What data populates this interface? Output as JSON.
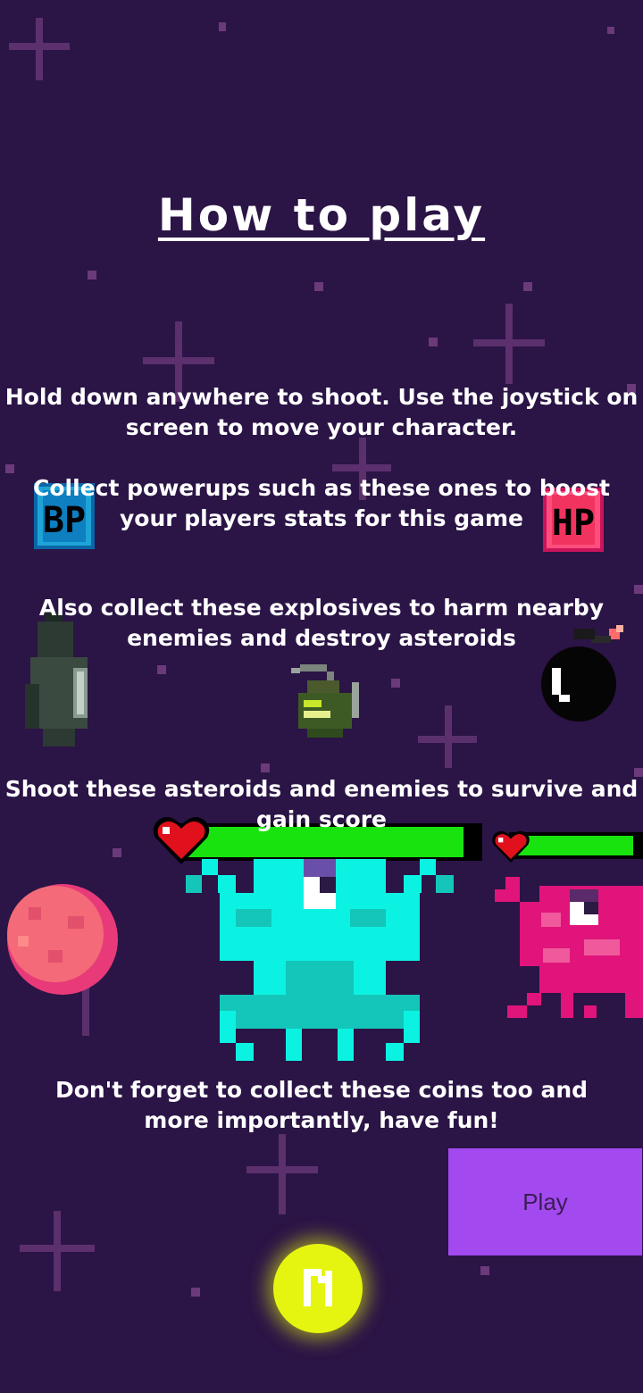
{
  "title": "How to play",
  "instructions": {
    "controls": "Hold down anywhere to shoot. Use the joystick on screen to move your character.",
    "powerups": "Collect powerups such as these ones to boost your players stats for this game",
    "explosives": "Also collect these explosives to harm nearby enemies and destroy asteroids",
    "enemies": "Shoot these asteroids and enemies to survive and gain score",
    "coins": "Don't forget to collect these coins too and more importantly, have fun!"
  },
  "powerups": {
    "left_label": "BP",
    "right_label": "HP"
  },
  "health": {
    "cyan_enemy": 0.95,
    "pink_enemy": 0.95
  },
  "buttons": {
    "play_label": "Play"
  },
  "colors": {
    "background": "#2b1446",
    "health_fill": "#19e30f",
    "play_button": "#a349f0",
    "coin": "#e6f510",
    "cyan_enemy": "#0cf2e2",
    "pink_enemy": "#e0147a"
  },
  "icons": [
    "bp-powerup-icon",
    "hp-powerup-icon",
    "missile-icon",
    "grenade-icon",
    "bomb-icon",
    "asteroid-icon",
    "heart-icon",
    "cyan-alien-enemy",
    "pink-alien-enemy",
    "coin-icon"
  ]
}
